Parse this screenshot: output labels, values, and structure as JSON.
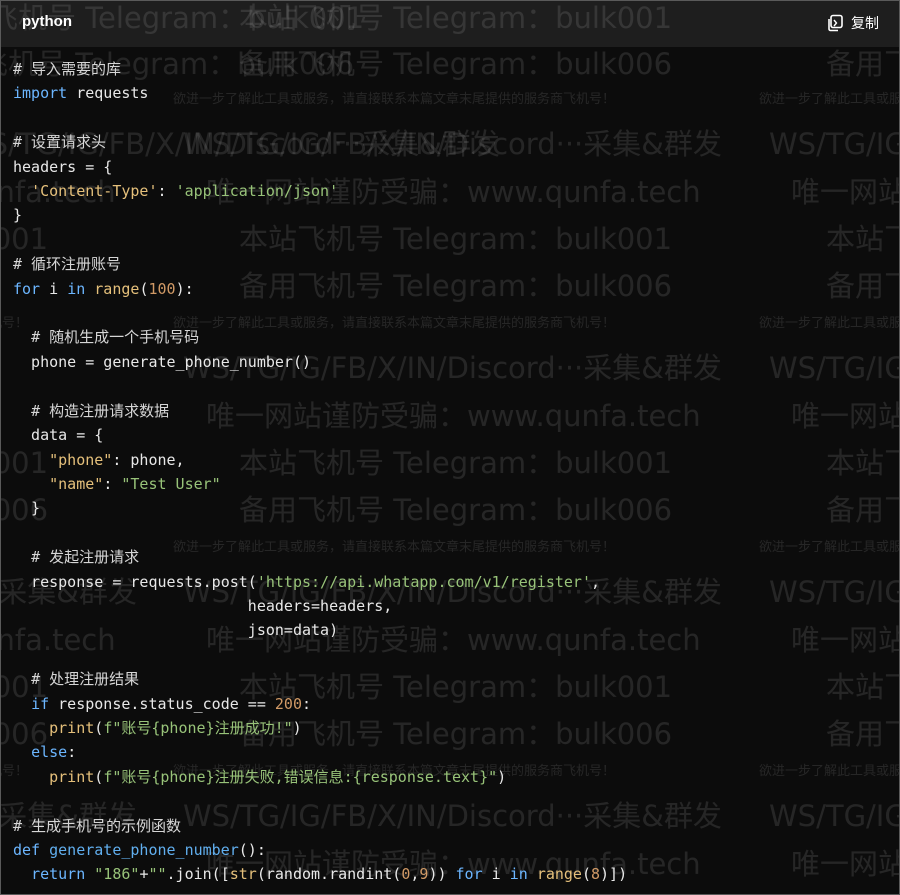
{
  "header": {
    "language": "python",
    "copy_label": "复制",
    "copy_icon": "copy-icon"
  },
  "watermarks": {
    "telegram_1": "本站飞机号 Telegram：bulk001",
    "telegram_2": "备用飞机号 Telegram：bulk006",
    "services": "WS/TG/IG/FB/X/IN/Discord···采集&群发",
    "anti_fraud": "唯一网站谨防受骗：www.qunfa.tech",
    "notice": "欲进一步了解此工具或服务，请直接联系本篇文章末尾提供的服务商飞机号！"
  },
  "code": {
    "l01": {
      "comment": "# 导入需要的库"
    },
    "l02": {
      "kw": "import",
      "rest": " requests"
    },
    "l04": {
      "comment": "# 设置请求头"
    },
    "l05": {
      "a": "headers = {"
    },
    "l06": {
      "indent": "  ",
      "key": "'Content-Type'",
      "colon": ": ",
      "val": "'application/json'"
    },
    "l07": {
      "a": "}"
    },
    "l09": {
      "comment": "# 循环注册账号"
    },
    "l10": {
      "kw1": "for",
      "a": " i ",
      "kw2": "in",
      "sp": " ",
      "bi": "range",
      "p1": "(",
      "num": "100",
      "p2": "):"
    },
    "l12": {
      "indent": "  ",
      "comment": "# 随机生成一个手机号码"
    },
    "l13": {
      "a": "  phone = generate_phone_number()"
    },
    "l15": {
      "indent": "  ",
      "comment": "# 构造注册请求数据"
    },
    "l16": {
      "a": "  data = {"
    },
    "l17": {
      "indent": "    ",
      "key": "\"phone\"",
      "rest": ": phone,"
    },
    "l18": {
      "indent": "    ",
      "key": "\"name\"",
      "colon": ": ",
      "val": "\"Test User\""
    },
    "l19": {
      "a": "  }"
    },
    "l21": {
      "indent": "  ",
      "comment": "# 发起注册请求"
    },
    "l22": {
      "a": "  response = requests.post(",
      "url": "'https://api.whatapp.com/v1/register'",
      "b": ","
    },
    "l23": {
      "a": "                          headers=headers,"
    },
    "l24": {
      "a": "                          json=data)"
    },
    "l26": {
      "indent": "  ",
      "comment": "# 处理注册结果"
    },
    "l27": {
      "indent": "  ",
      "kw": "if",
      "a": " response.status_code == ",
      "num": "200",
      "b": ":"
    },
    "l28": {
      "indent": "    ",
      "bi": "print",
      "p1": "(",
      "str": "f\"账号{phone}注册成功!\"",
      "p2": ")"
    },
    "l29": {
      "indent": "  ",
      "kw": "else",
      "b": ":"
    },
    "l30": {
      "indent": "    ",
      "bi": "print",
      "p1": "(",
      "str": "f\"账号{phone}注册失败,错误信息:{response.text}\"",
      "p2": ")"
    },
    "l32": {
      "comment": "# 生成手机号的示例函数"
    },
    "l33": {
      "kw": "def",
      "sp": " ",
      "fn": "generate_phone_number",
      "b": "():"
    },
    "l34": {
      "indent": "  ",
      "kw": "return",
      "sp": " ",
      "str1": "\"186\"",
      "op": "+",
      "str2": "\"\"",
      "a": ".join([",
      "bi1": "str",
      "b": "(random.randint(",
      "n1": "0",
      "c": ",",
      "n2": "9",
      "d": ")) ",
      "kw2": "for",
      "e": " i ",
      "kw3": "in",
      "sp2": " ",
      "bi2": "range",
      "f": "(",
      "n3": "8",
      "g": ")])"
    }
  }
}
